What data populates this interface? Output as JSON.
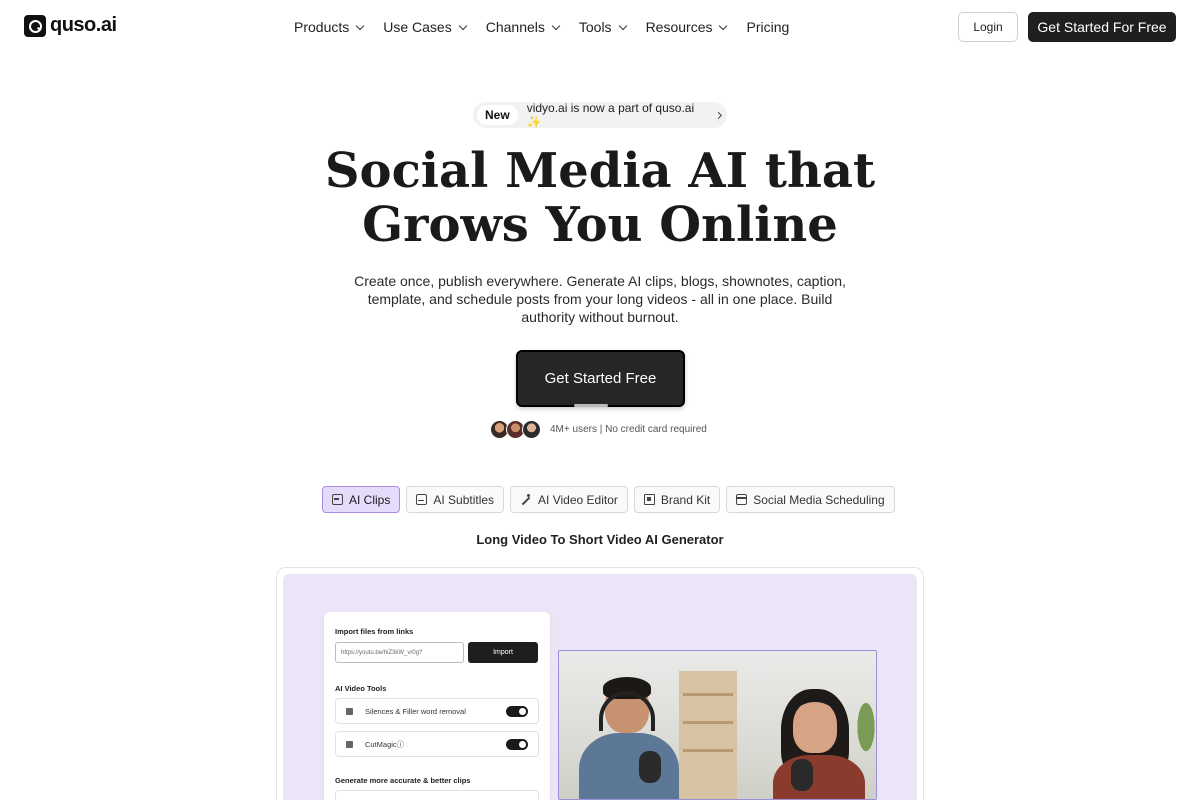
{
  "header": {
    "logo_text": "quso.ai",
    "nav": [
      {
        "label": "Products",
        "dropdown": true
      },
      {
        "label": "Use Cases",
        "dropdown": true
      },
      {
        "label": "Channels",
        "dropdown": true
      },
      {
        "label": "Tools",
        "dropdown": true
      },
      {
        "label": "Resources",
        "dropdown": true
      },
      {
        "label": "Pricing",
        "dropdown": false
      }
    ],
    "login_label": "Login",
    "cta_label": "Get Started For Free"
  },
  "announcement": {
    "badge": "New",
    "text": "vidyo.ai is now a part of quso.ai ✨"
  },
  "hero": {
    "title_line1": "Social Media AI that",
    "title_line2": "Grows You Online",
    "subtitle": "Create once, publish everywhere. Generate AI clips, blogs, shownotes, caption, template, and schedule posts from your long videos - all in one place. Build authority without burnout.",
    "cta_label": "Get Started Free",
    "social_proof": "4M+ users | No credit card required"
  },
  "tabs": [
    {
      "label": "AI Clips",
      "icon": "clips-icon",
      "active": true
    },
    {
      "label": "AI Subtitles",
      "icon": "subtitles-icon",
      "active": false
    },
    {
      "label": "AI Video Editor",
      "icon": "wand-icon",
      "active": false
    },
    {
      "label": "Brand Kit",
      "icon": "brand-kit-icon",
      "active": false
    },
    {
      "label": "Social Media Scheduling",
      "icon": "calendar-icon",
      "active": false
    }
  ],
  "section_title": "Long Video To Short Video AI Generator",
  "demo": {
    "import_label": "Import files from links",
    "url_value": "https://youtu.be/hiZ3kW_vr0g?",
    "import_button": "Import",
    "tools_label": "AI Video Tools",
    "tool_rows": [
      {
        "label": "Silences & Filler word removal",
        "enabled": true
      },
      {
        "label": "CutMagicⓘ",
        "enabled": true
      }
    ],
    "more_label": "Generate more accurate & better clips"
  },
  "colors": {
    "accent_purple": "#e6dbfb",
    "dark_button": "#1f1f1f",
    "demo_bg": "#ece4f7"
  }
}
